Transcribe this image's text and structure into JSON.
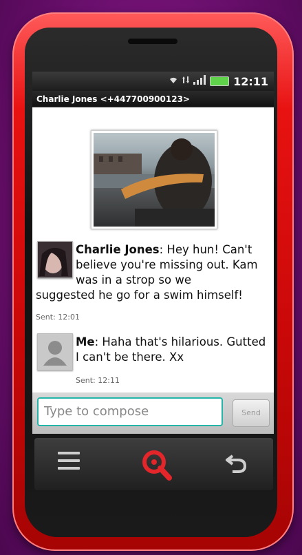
{
  "status_bar": {
    "time": "12:11",
    "icons": [
      "wifi-icon",
      "data-arrows-icon",
      "signal-icon",
      "battery-icon"
    ],
    "battery_color": "#5fd44a"
  },
  "conversation": {
    "title": "Charlie Jones <+447700900123>"
  },
  "messages": [
    {
      "sender": "Charlie Jones",
      "text": ": Hey hun! Can't believe you're missing out. Kam was in a strop so we suggested he go for a swim himself!",
      "sent": "Sent: 12:01"
    },
    {
      "sender": "Me",
      "text": ": Haha that's hilarious. Gutted I can't be there. Xx",
      "sent": "Sent: 12:11"
    }
  ],
  "compose": {
    "placeholder": "Type to compose",
    "send_label": "Send",
    "border_color": "#23b5a7"
  },
  "nav": {
    "icons": [
      "menu-icon",
      "search-icon",
      "back-icon"
    ],
    "search_color": "#e2262a"
  },
  "phone": {
    "body_color": "#e81212",
    "background_color": "#6a0f6d"
  }
}
